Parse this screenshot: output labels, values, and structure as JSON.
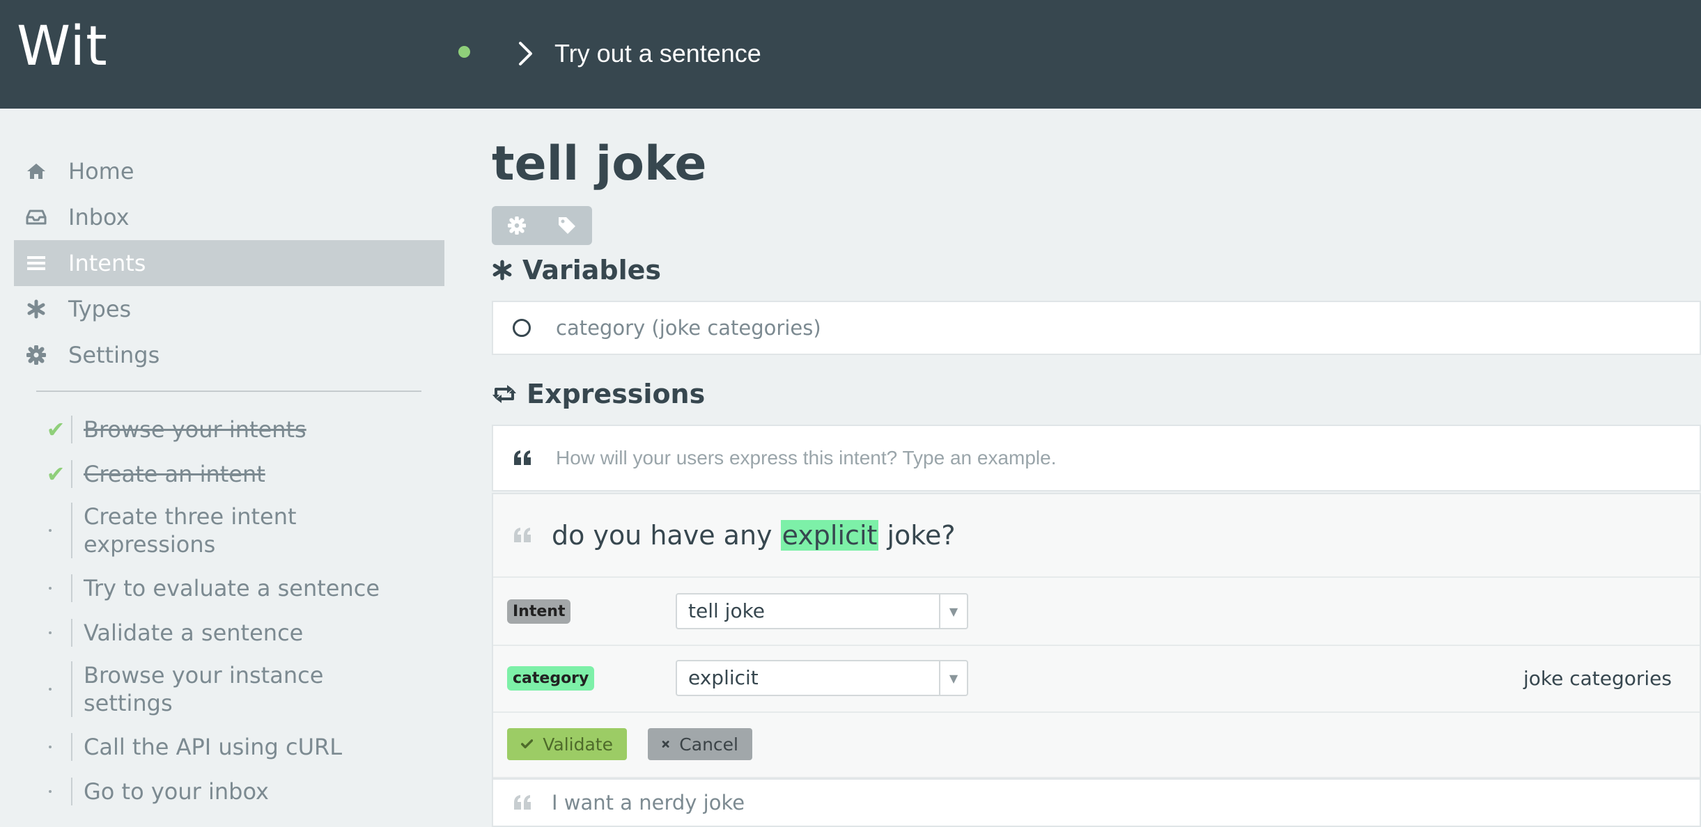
{
  "app": {
    "name": "Wit"
  },
  "topbar": {
    "try_label": "Try out a sentence"
  },
  "sidebar": {
    "items": [
      {
        "label": "Home",
        "icon": "home-icon"
      },
      {
        "label": "Inbox",
        "icon": "inbox-icon"
      },
      {
        "label": "Intents",
        "icon": "list-icon",
        "active": true
      },
      {
        "label": "Types",
        "icon": "asterisk-icon"
      },
      {
        "label": "Settings",
        "icon": "gear-icon"
      }
    ],
    "tasks": [
      {
        "label": "Browse your intents",
        "done": true
      },
      {
        "label": "Create an intent",
        "done": true
      },
      {
        "label": "Create three intent expressions",
        "done": false
      },
      {
        "label": "Try to evaluate a sentence",
        "done": false
      },
      {
        "label": "Validate a sentence",
        "done": false
      },
      {
        "label": "Browse your instance settings",
        "done": false
      },
      {
        "label": "Call the API using cURL",
        "done": false
      },
      {
        "label": "Go to your inbox",
        "done": false
      }
    ]
  },
  "main": {
    "title": "tell joke",
    "variables": {
      "heading": "Variables",
      "items": [
        {
          "label": "category (joke categories)"
        }
      ]
    },
    "expressions": {
      "heading": "Expressions",
      "input_placeholder": "How will your users express this intent? Type an example.",
      "active": {
        "before": "do you have any ",
        "highlight": "explicit",
        "after": " joke?",
        "intent_badge": "Intent",
        "intent_value": "tell joke",
        "entity_badge": "category",
        "entity_value": "explicit",
        "entity_type": "joke categories",
        "validate_label": "Validate",
        "cancel_label": "Cancel"
      },
      "next": {
        "text": "I want a nerdy joke"
      }
    }
  },
  "colors": {
    "topbar": "#37474f",
    "accent_green": "#8fcf7a",
    "highlight": "#7df0a8"
  }
}
